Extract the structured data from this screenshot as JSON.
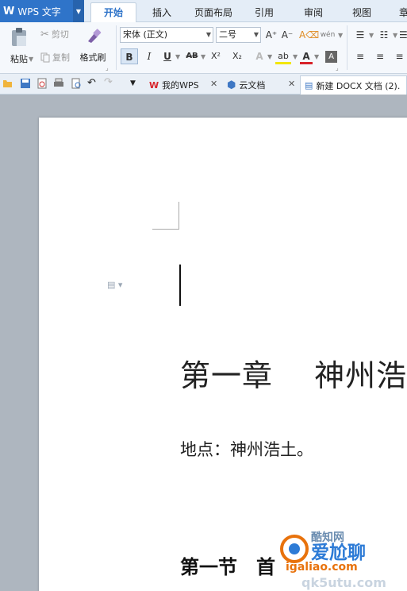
{
  "app": {
    "logo": "W",
    "name": "WPS 文字"
  },
  "menu_tabs": [
    "开始",
    "插入",
    "页面布局",
    "引用",
    "审阅",
    "视图",
    "章"
  ],
  "ribbon": {
    "paste": "粘贴",
    "cut": "剪切",
    "copy": "复制",
    "format_painter": "格式刷",
    "font_name": "宋体 (正文)",
    "font_size": "二号",
    "grow_font": "A⁺",
    "shrink_font": "A⁻",
    "bold": "B",
    "italic": "I",
    "underline": "U",
    "strike": "AB",
    "superscript": "X²",
    "subscript": "X₂",
    "phonetic": "wén",
    "font_color_letter": "A",
    "highlight_letter": "ab"
  },
  "doc_tabs": [
    {
      "label": "我的WPS",
      "icon": "wps-icon"
    },
    {
      "label": "云文档",
      "icon": "cloud-doc-icon"
    },
    {
      "label": "新建 DOCX 文档 (2).",
      "icon": "document-icon"
    }
  ],
  "document": {
    "chapter_title": "第一章　 神州浩",
    "location": "地点：神州浩土。",
    "section_title": "第一节　首"
  },
  "watermark": {
    "brand": "爱尬聊",
    "top": "酷知网",
    "url": "igaliao.com",
    "bottom": "qk5utu.com"
  },
  "colors": {
    "app_blue": "#2f74c9",
    "ribbon_bg": "#f5f8fc",
    "canvas_bg": "#aeb6bf",
    "active_tab_text": "#2f74c9",
    "watermark_blue": "#2d7bd6",
    "watermark_orange": "#e8720c"
  }
}
